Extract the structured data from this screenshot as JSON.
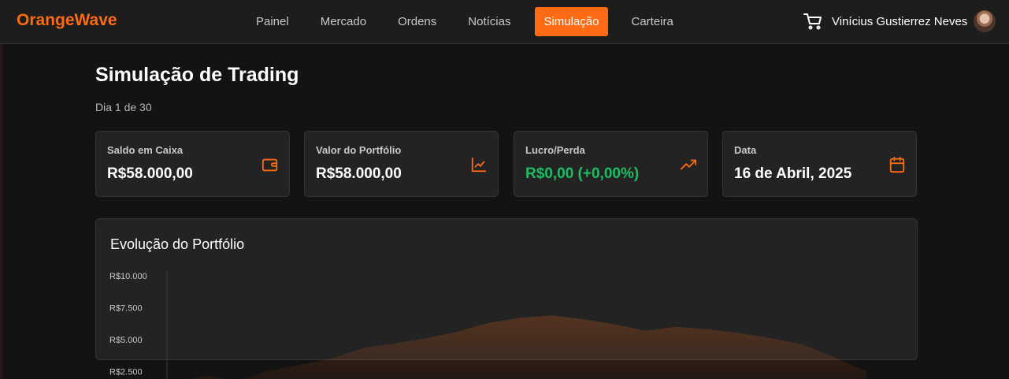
{
  "app": {
    "name": "OrangeWave",
    "accent": "#ff6a13"
  },
  "nav": {
    "items": [
      "Painel",
      "Mercado",
      "Ordens",
      "Notícias",
      "Simulação",
      "Carteira"
    ],
    "active_index": 4
  },
  "header": {
    "user_name": "Vinícius Gustierrez Neves",
    "cart_icon": "shopping-cart-icon"
  },
  "page": {
    "title": "Simulação de Trading",
    "subtitle": "Dia 1 de 30"
  },
  "cards": [
    {
      "label": "Saldo em Caixa",
      "value": "R$58.000,00",
      "icon": "wallet-icon"
    },
    {
      "label": "Valor do Portfólio",
      "value": "R$58.000,00",
      "icon": "line-chart-icon"
    },
    {
      "label": "Lucro/Perda",
      "value": "R$0,00 (+0,00%)",
      "icon": "trending-up-icon",
      "value_color": "#1ebd63"
    },
    {
      "label": "Data",
      "value": "16 de Abril, 2025",
      "icon": "calendar-icon"
    }
  ],
  "chart": {
    "title": "Evolução do Portfólio"
  },
  "chart_data": {
    "type": "area",
    "title": "Evolução do Portfólio",
    "y_ticks": [
      "R$10.000",
      "R$7.500",
      "R$5.000",
      "R$2.500"
    ],
    "ylim": [
      0,
      10000
    ],
    "series": [
      {
        "values": [
          1500,
          2200,
          1800,
          2500,
          3000,
          3500,
          4300,
          4700,
          5100,
          5600,
          6300,
          6700,
          6900,
          6600,
          6200,
          5700,
          6000,
          5800,
          5500,
          5100,
          4600,
          3600,
          2500
        ],
        "color": "#ff6a13"
      }
    ]
  }
}
